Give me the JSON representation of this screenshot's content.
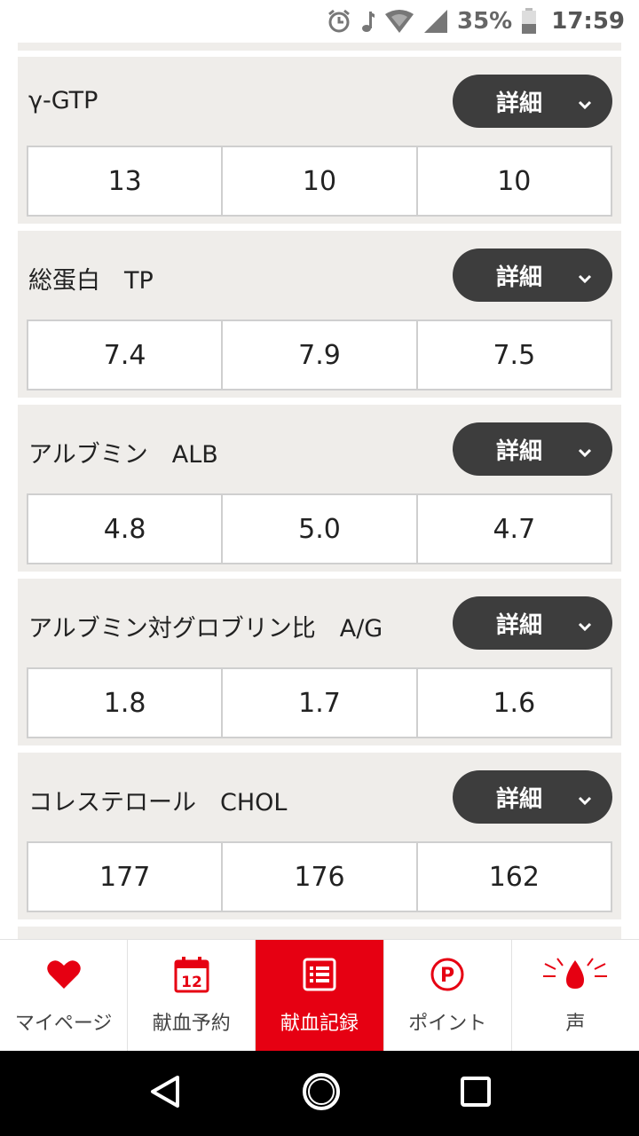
{
  "status_bar": {
    "battery_percent": "35%",
    "time": "17:59"
  },
  "cards": [
    {
      "title": "γ-GTP",
      "detail_label": "詳細",
      "values": [
        "13",
        "10",
        "10"
      ]
    },
    {
      "title": "総蛋白　TP",
      "detail_label": "詳細",
      "values": [
        "7.4",
        "7.9",
        "7.5"
      ]
    },
    {
      "title": "アルブミン　ALB",
      "detail_label": "詳細",
      "values": [
        "4.8",
        "5.0",
        "4.7"
      ]
    },
    {
      "title": "アルブミン対グロブリン比　A/G",
      "detail_label": "詳細",
      "values": [
        "1.8",
        "1.7",
        "1.6"
      ]
    },
    {
      "title": "コレステロール　CHOL",
      "detail_label": "詳細",
      "values": [
        "177",
        "176",
        "162"
      ]
    }
  ],
  "bottom_nav": {
    "items": [
      {
        "label": "マイページ",
        "icon": "heart-icon",
        "active": false
      },
      {
        "label": "献血予約",
        "icon": "calendar-icon",
        "calendar_day": "12",
        "active": false
      },
      {
        "label": "献血記録",
        "icon": "list-icon",
        "active": true
      },
      {
        "label": "ポイント",
        "icon": "point-icon",
        "icon_letter": "P",
        "active": false
      },
      {
        "label": "声",
        "icon": "blood-drop-icon",
        "active": false
      }
    ]
  },
  "colors": {
    "brand_red": "#e60012",
    "card_bg": "#efedea",
    "button_dark": "#3d3d3d"
  }
}
